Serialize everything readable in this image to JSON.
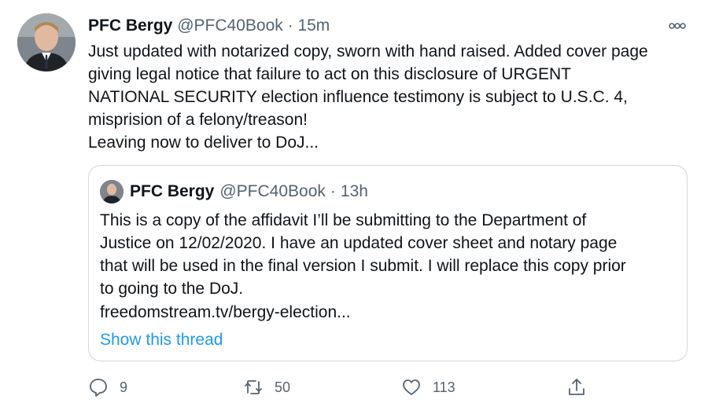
{
  "tweet": {
    "author_name": "PFC Bergy",
    "author_handle": "@PFC40Book",
    "separator": "·",
    "time": "15m",
    "text": "Just updated with notarized copy, sworn with hand raised. Added cover page\ngiving legal notice that failure to act on this disclosure of URGENT\nNATIONAL SECURITY election influence testimony is subject to U.S.C. 4,\nmisprision of a felony/treason!\nLeaving now to deliver to DoJ...",
    "more_icon": "more-horizontal-icon"
  },
  "quoted": {
    "author_name": "PFC Bergy",
    "author_handle": "@PFC40Book",
    "separator": "·",
    "time": "13h",
    "text": "This is a copy of the affidavit I’ll be submitting to the Department of\nJustice on 12/02/2020. I have an updated cover sheet and notary page\nthat will be used in the final version I submit. I will replace this copy prior\nto going to the DoJ.",
    "link": "freedomstream.tv/bergy-election...",
    "show_thread": "Show this thread"
  },
  "actions": {
    "reply_count": "9",
    "retweet_count": "50",
    "like_count": "113"
  },
  "colors": {
    "link": "#1d9bf0",
    "secondary": "#536471",
    "border": "#cfd9de"
  }
}
